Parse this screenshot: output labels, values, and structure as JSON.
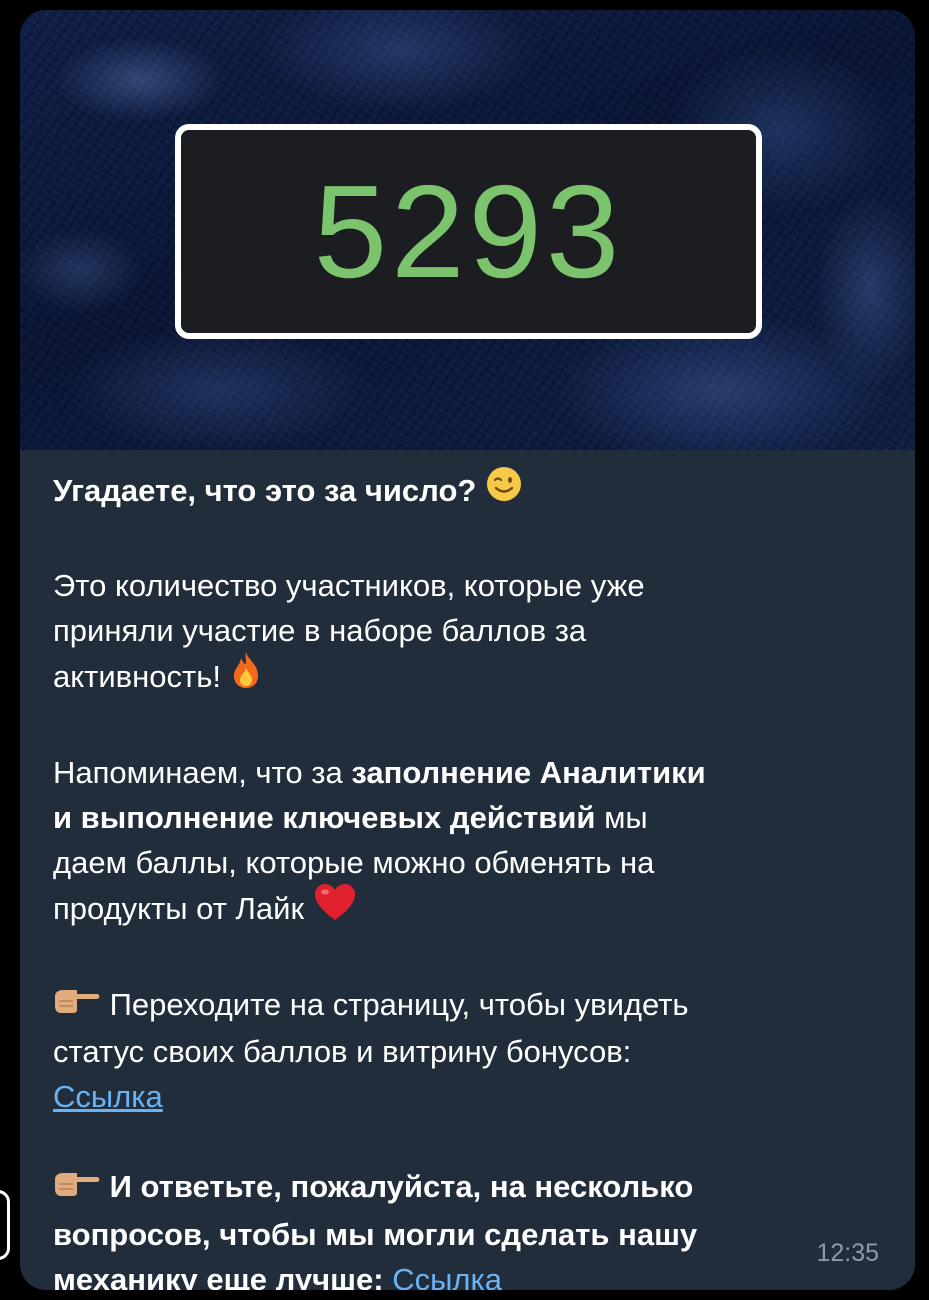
{
  "message": {
    "image_counter": "5293",
    "line_title": "Угадаете, что это за число?",
    "para2": {
      "line1": "Это количество участников, которые уже",
      "line2": "приняли участие в наборе баллов за",
      "line3": "активность!"
    },
    "para3": {
      "text1": "Напоминаем, что за ",
      "bold1": "заполнение Аналитики",
      "bold2": "и выполнение ключевых действий",
      "text2": " мы",
      "line3": "даем баллы, которые можно обменять на",
      "line4": "продукты от Лайк"
    },
    "para4": {
      "line1": "Переходите на страницу, чтобы увидеть",
      "line2": "статус своих баллов и витрину бонусов:",
      "link": "Ссылка"
    },
    "para5": {
      "line1": "И ответьте, пожалуйста, на несколько",
      "line2": "вопросов, чтобы мы могли сделать нашу",
      "line3": "механику еще лучше: ",
      "link": "Ссылка"
    },
    "time": "12:35"
  },
  "icons": {
    "wink": "winking-face-emoji",
    "fire": "fire-emoji",
    "heart": "red-heart-emoji",
    "pointing": "backhand-index-pointing-right-emoji"
  },
  "colors": {
    "bubble_bg": "#212d3b",
    "counter_text": "#7cc36e",
    "link": "#6ab3f3",
    "timestamp": "#8a9bad"
  }
}
